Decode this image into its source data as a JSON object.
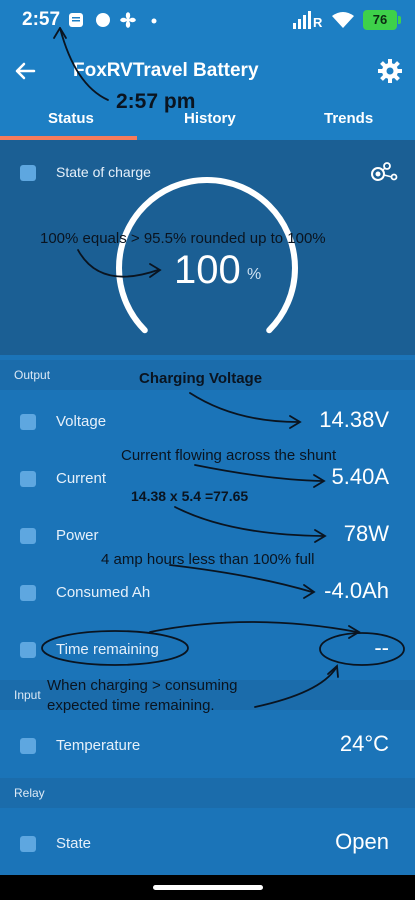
{
  "status_bar": {
    "time": "2:57",
    "battery_level": "76"
  },
  "app_bar": {
    "title": "FoxRVTravel Battery",
    "tabs": [
      {
        "label": "Status",
        "active": true
      },
      {
        "label": "History",
        "active": false
      },
      {
        "label": "Trends",
        "active": false
      }
    ]
  },
  "soc": {
    "label": "State of charge",
    "value": "100",
    "unit": "%",
    "gauge_fraction": 1.0
  },
  "sections": {
    "output": "Output",
    "input": "Input",
    "relay": "Relay"
  },
  "rows": {
    "voltage": {
      "label": "Voltage",
      "value": "14.38V"
    },
    "current": {
      "label": "Current",
      "value": "5.40A"
    },
    "power": {
      "label": "Power",
      "value": "78W"
    },
    "consumed": {
      "label": "Consumed Ah",
      "value": "-4.0Ah"
    },
    "time_remaining": {
      "label": "Time remaining",
      "value": "--"
    },
    "temperature": {
      "label": "Temperature",
      "value": "24°C"
    },
    "relay_state": {
      "label": "State",
      "value": "Open"
    }
  },
  "annotations": {
    "time_note": "2:57 pm",
    "soc_note": "100% equals > 95.5% rounded up to 100%",
    "charging_voltage": "Charging Voltage",
    "current_note": "Current flowing across the shunt",
    "power_calc": "14.38 x 5.4 =77.65",
    "consumed_note": "4 amp hours less than 100%  full",
    "time_remaining_note_1": "When charging > consuming",
    "time_remaining_note_2": "expected time remaining."
  },
  "colors": {
    "header": "#1d7fc4",
    "background": "#1b74b8",
    "soc_panel": "#1b5f94",
    "accent_tab": "#f47b5c",
    "battery": "#3ed14a"
  }
}
